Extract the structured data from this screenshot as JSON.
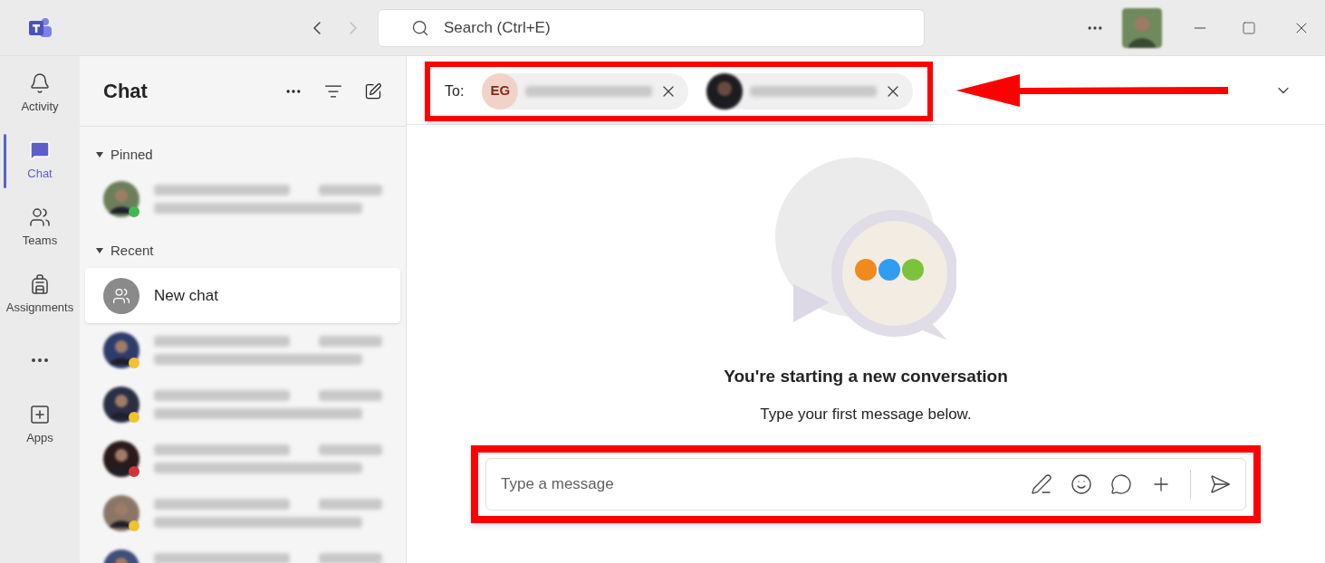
{
  "titlebar": {
    "search": {
      "placeholder": "Search (Ctrl+E)"
    }
  },
  "rail": [
    {
      "kind": "activity",
      "label": "Activity",
      "selected": false
    },
    {
      "kind": "chat",
      "label": "Chat",
      "selected": true
    },
    {
      "kind": "teams",
      "label": "Teams",
      "selected": false
    },
    {
      "kind": "assignments",
      "label": "Assignments",
      "selected": false
    },
    {
      "kind": "more"
    },
    {
      "kind": "apps",
      "label": "Apps",
      "selected": false
    }
  ],
  "chat_list": {
    "title": "Chat",
    "sections": [
      {
        "title": "Pinned",
        "expanded": true,
        "items": [
          {
            "kind": "blurred",
            "color": "#3fb950",
            "selected": false
          }
        ]
      },
      {
        "title": "Recent",
        "expanded": true,
        "items": [
          {
            "kind": "new",
            "label": "New chat",
            "selected": true
          },
          {
            "kind": "blurred",
            "color": "#f2c230",
            "selected": false
          },
          {
            "kind": "blurred",
            "color": "#f2c230",
            "selected": false
          },
          {
            "kind": "blurred",
            "color": "#d13438",
            "selected": false
          },
          {
            "kind": "blurred",
            "color": "#f2c230",
            "selected": false
          },
          {
            "kind": "blurred",
            "selected": false
          }
        ]
      }
    ]
  },
  "to_bar": {
    "label": "To:",
    "recipients": [
      {
        "kind": "initials",
        "initials": "EG"
      },
      {
        "kind": "photo"
      }
    ]
  },
  "empty_state": {
    "title": "You're starting a new conversation",
    "subtitle": "Type your first message below."
  },
  "composer": {
    "placeholder": "Type a message"
  }
}
